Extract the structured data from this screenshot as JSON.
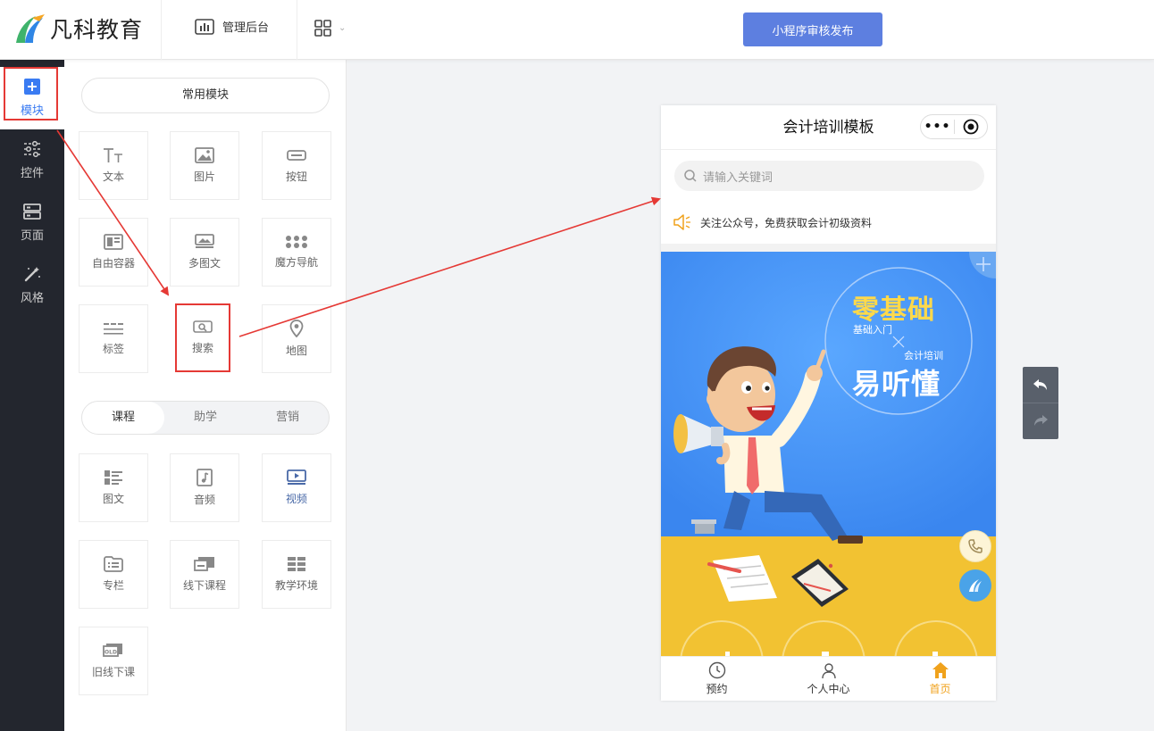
{
  "header": {
    "logo_text": "凡科教育",
    "admin_label": "管理后台",
    "publish_button": "小程序审核发布"
  },
  "leftnav": {
    "items": [
      {
        "label": "模块",
        "icon": "plus-square-icon"
      },
      {
        "label": "控件",
        "icon": "sliders-icon"
      },
      {
        "label": "页面",
        "icon": "page-layout-icon"
      },
      {
        "label": "风格",
        "icon": "magic-wand-icon"
      }
    ]
  },
  "panel": {
    "common_title": "常用模块",
    "common_modules": [
      {
        "label": "文本",
        "icon": "text-icon"
      },
      {
        "label": "图片",
        "icon": "image-icon"
      },
      {
        "label": "按钮",
        "icon": "button-icon"
      },
      {
        "label": "自由容器",
        "icon": "container-icon"
      },
      {
        "label": "多图文",
        "icon": "multi-image-text-icon"
      },
      {
        "label": "魔方导航",
        "icon": "grid-dots-icon"
      },
      {
        "label": "标签",
        "icon": "tabs-icon"
      },
      {
        "label": "搜索",
        "icon": "search-icon"
      },
      {
        "label": "地图",
        "icon": "map-pin-icon"
      }
    ],
    "tabs": [
      "课程",
      "助学",
      "营销"
    ],
    "active_tab": "课程",
    "course_modules": [
      {
        "label": "图文",
        "icon": "list-image-icon"
      },
      {
        "label": "音频",
        "icon": "audio-icon"
      },
      {
        "label": "视频",
        "icon": "video-icon"
      },
      {
        "label": "专栏",
        "icon": "folder-icon"
      },
      {
        "label": "线下课程",
        "icon": "offline-course-icon"
      },
      {
        "label": "教学环境",
        "icon": "environment-icon"
      },
      {
        "label": "旧线下课",
        "icon": "old-offline-icon"
      }
    ]
  },
  "phone": {
    "title": "会计培训模板",
    "capsule_dots": "•••",
    "search_placeholder": "请输入关键词",
    "notice": "关注公众号，免费获取会计初级资料",
    "banner": {
      "headline1": "零基础",
      "sub1": "基础入门",
      "sub2": "会计培训",
      "headline2": "易听懂"
    },
    "bottom_nav": [
      {
        "label": "预约",
        "icon": "clock-icon"
      },
      {
        "label": "个人中心",
        "icon": "user-icon"
      },
      {
        "label": "首页",
        "icon": "home-icon"
      }
    ]
  },
  "colors": {
    "accent": "#5d7fe0",
    "nav_bg": "#23262e",
    "active_blue": "#3a7bf2",
    "highlight_red": "#e53935",
    "banner_blue": "#3f8ff2",
    "banner_yellow": "#f2c232",
    "home_orange": "#f0a21c"
  }
}
